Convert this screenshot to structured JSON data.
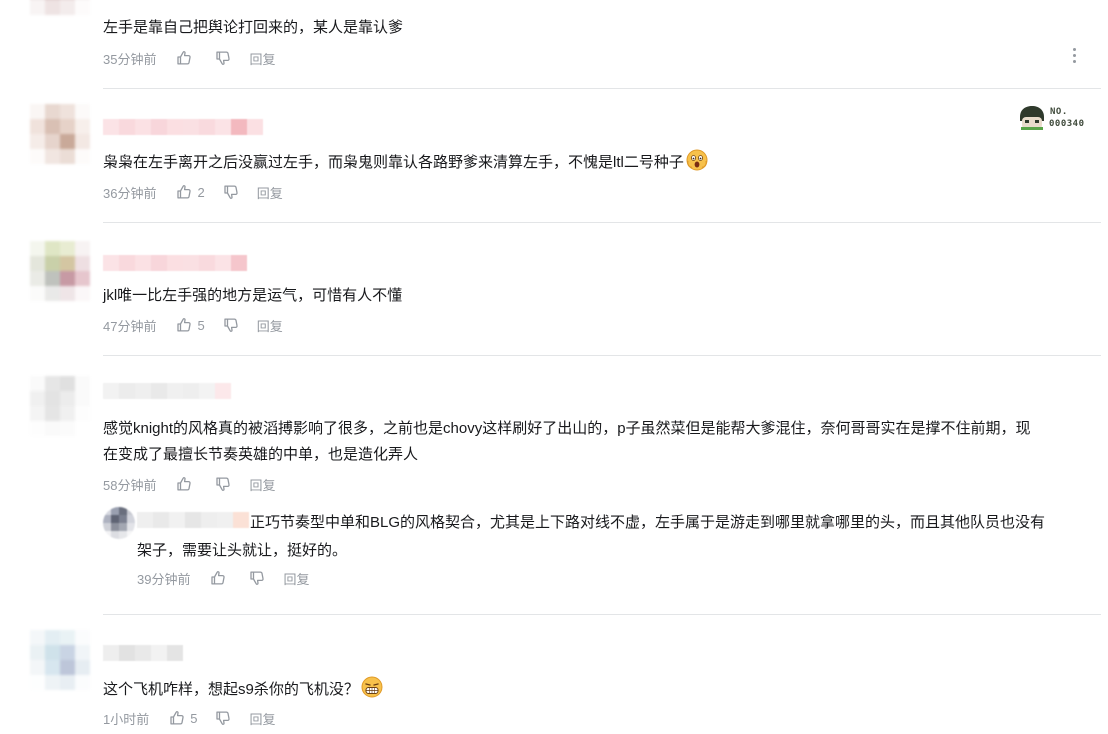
{
  "colors": {
    "meta": "#9499a0",
    "divider": "#e3e5e7",
    "text": "#18191c"
  },
  "comments": [
    {
      "text": "左手是靠自己把舆论打回来的，某人是靠认爹",
      "time": "35分钟前",
      "likes": "",
      "reply": "回复"
    },
    {
      "text": "枭枭在左手离开之后没赢过左手，而枭鬼则靠认各路野爹来清算左手，不愧是ltl二号种子",
      "emoji": "scream-emoji",
      "time": "36分钟前",
      "likes": "2",
      "reply": "回复",
      "badge": {
        "label": "NO.",
        "number": "000340",
        "icon": "fan-badge-face-icon"
      }
    },
    {
      "text": "jkl唯一比左手强的地方是运气，可惜有人不懂",
      "time": "47分钟前",
      "likes": "5",
      "reply": "回复"
    },
    {
      "text_line1": "感觉knight的风格真的被滔搏影响了很多，之前也是chovy这样刷好了出山的，p子虽然菜但是能帮大爹混住，奈何哥哥实在是撑不住前期，现",
      "text_line2": "在变成了最擅长节奏英雄的中单，也是造化弄人",
      "time": "58分钟前",
      "likes": "",
      "reply": "回复",
      "sub_reply": {
        "text_line1": "正巧节奏型中单和BLG的风格契合，尤其是上下路对线不虚，左手属于是游走到哪里就拿哪里的头，而且其他队员也没有",
        "text_line2": "架子，需要让头就让，挺好的。",
        "time": "39分钟前",
        "likes": "",
        "reply": "回复"
      }
    },
    {
      "text": "这个飞机咋样，想起s9杀你的飞机没？",
      "emoji": "grin-emoji",
      "time": "1小时前",
      "likes": "5",
      "reply": "回复"
    }
  ]
}
